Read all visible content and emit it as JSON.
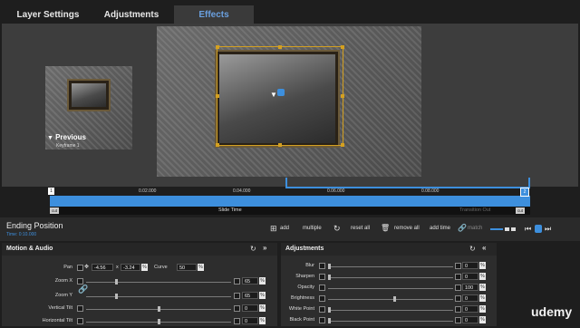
{
  "tabs": [
    {
      "label": "Layer Settings"
    },
    {
      "label": "Adjustments"
    },
    {
      "label": "Effects"
    }
  ],
  "preview": {
    "previous_label": "Previous",
    "previous_sub": "Keyframe 1"
  },
  "timeline": {
    "ticks": [
      "0.02.000",
      "0.04.000",
      "0.06.000",
      "0.08.000"
    ],
    "slide_time_label": "Slide Time",
    "transition_out_label": "Transition Out",
    "start_badge": "1",
    "end_badge": "2",
    "cut_left": "cut",
    "cut_right": "cut"
  },
  "ending": {
    "title": "Ending Position",
    "time": "Time: 0:10.000",
    "toolbar": {
      "add": "add",
      "multiple": "multiple",
      "reset_all": "reset all",
      "remove_all": "remove all",
      "add_time": "add time",
      "match": "match"
    }
  },
  "motion": {
    "title": "Motion & Audio",
    "pan_label": "Pan",
    "pan_x": "-4.56",
    "pan_y": "-3.24",
    "x_sep": "x",
    "curve_label": "Curve",
    "curve_value": "50",
    "pct": "%",
    "zoom_x_label": "Zoom X",
    "zoom_x": "65",
    "zoom_y_label": "Zoom Y",
    "zoom_y": "65",
    "vtilt_label": "Vertical Tilt",
    "vtilt": "0",
    "htilt_label": "Horizontal Tilt",
    "htilt": "0"
  },
  "adjust": {
    "title": "Adjustments",
    "rows": [
      {
        "label": "Blur",
        "value": "0"
      },
      {
        "label": "Sharpen",
        "value": "0"
      },
      {
        "label": "Opacity",
        "value": "100"
      },
      {
        "label": "Brightness",
        "value": "0"
      },
      {
        "label": "White Point",
        "value": "0"
      },
      {
        "label": "Black Point",
        "value": "0"
      }
    ]
  },
  "watermark": "udemy",
  "colors": {
    "accent": "#3d8fdd",
    "gold": "#d4a020"
  }
}
